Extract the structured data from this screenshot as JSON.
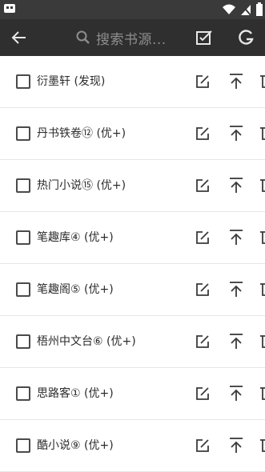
{
  "toolbar": {
    "search_placeholder": "搜索书源..."
  },
  "sources": [
    {
      "name": "衍墨轩 (发现)"
    },
    {
      "name": "丹书铁卷⑫ (优+)"
    },
    {
      "name": "热门小说⑮ (优+)"
    },
    {
      "name": "笔趣库④ (优+)"
    },
    {
      "name": "笔趣阁⑤ (优+)"
    },
    {
      "name": "梧州中文台⑥ (优+)"
    },
    {
      "name": "思路客① (优+)"
    },
    {
      "name": "酷小说⑨ (优+)"
    }
  ],
  "icons": {
    "back": "arrow-left",
    "search": "magnifier",
    "edit_all": "checkbox-edit",
    "refresh": "g-letter",
    "row_edit": "pencil-square",
    "row_top": "pin-to-top",
    "row_delete": "trash"
  },
  "colors": {
    "toolbar": "#2f2f2f",
    "status_bar": "#3a3a3a",
    "row_text": "#2b2b2b",
    "divider": "#e6e6e6"
  }
}
